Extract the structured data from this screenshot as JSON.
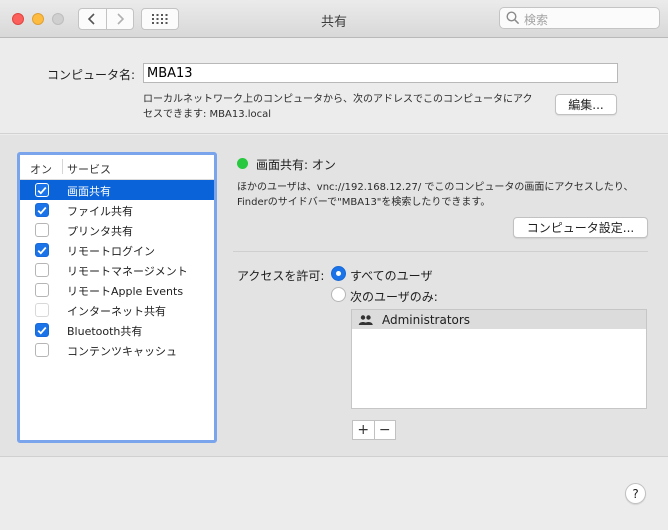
{
  "window": {
    "title": "共有"
  },
  "toolbar": {
    "search_placeholder": "検索"
  },
  "computer_name": {
    "label": "コンピュータ名:",
    "value": "MBA13",
    "description_line1": "ローカルネットワーク上のコンピュータから、次のアドレスでこのコンピュータにアク",
    "description_line2": "セスできます: MBA13.local",
    "edit_button": "編集..."
  },
  "services": {
    "header_on": "オン",
    "header_service": "サービス",
    "items": [
      {
        "label": "画面共有",
        "checked": true,
        "selected": true
      },
      {
        "label": "ファイル共有",
        "checked": true
      },
      {
        "label": "プリンタ共有",
        "checked": false
      },
      {
        "label": "リモートログイン",
        "checked": true
      },
      {
        "label": "リモートマネージメント",
        "checked": false
      },
      {
        "label": "リモートApple Events",
        "checked": false
      },
      {
        "label": "インターネット共有",
        "checked": false,
        "disabled": true
      },
      {
        "label": "Bluetooth共有",
        "checked": true
      },
      {
        "label": "コンテンツキャッシュ",
        "checked": false
      }
    ]
  },
  "detail": {
    "status": "画面共有: オン",
    "status_color": "#28c840",
    "description_line1": "ほかのユーザは、vnc://192.168.12.27/ でこのコンピュータの画面にアクセスしたり、",
    "description_line2": "Finderのサイドバーで\"MBA13\"を検索したりできます。",
    "computer_settings_button": "コンピュータ設定...",
    "access_label": "アクセスを許可:",
    "radio_all": "すべてのユーザ",
    "radio_only": "次のユーザのみ:",
    "users": [
      "Administrators"
    ],
    "add_button": "+",
    "remove_button": "−"
  },
  "help_button": "?"
}
